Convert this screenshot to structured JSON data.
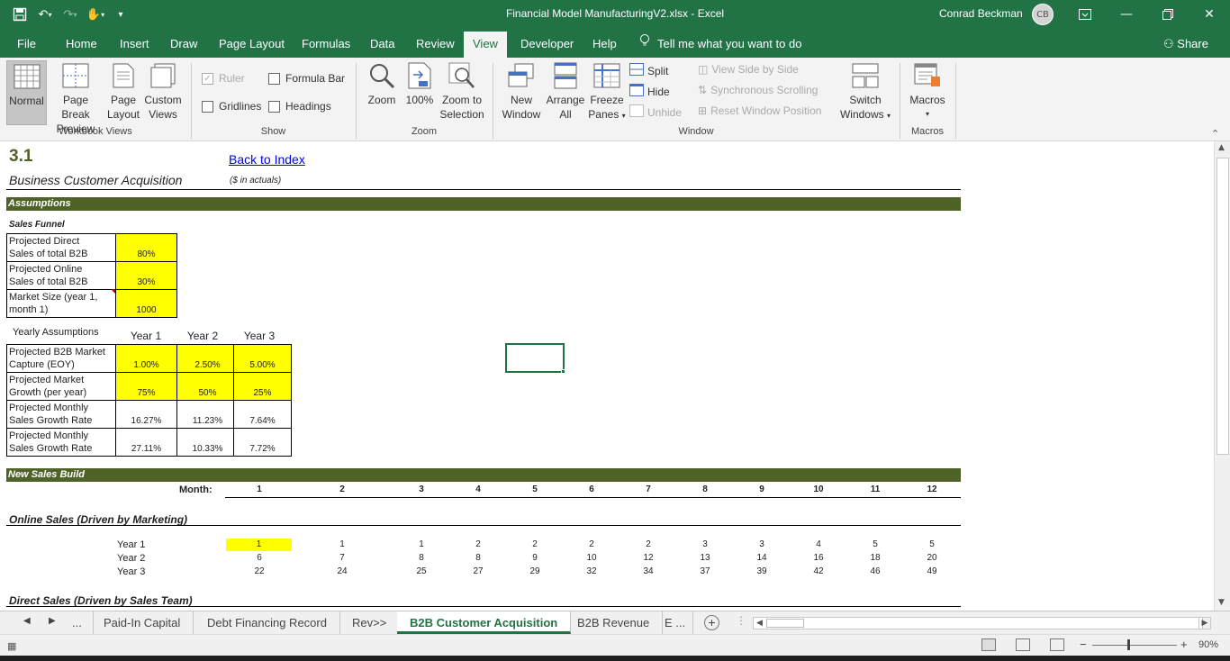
{
  "window": {
    "title": "Financial Model ManufacturingV2.xlsx  -  Excel",
    "user": "Conrad Beckman",
    "initials": "CB"
  },
  "menu": {
    "tabs": [
      "File",
      "Home",
      "Insert",
      "Draw",
      "Page Layout",
      "Formulas",
      "Data",
      "Review",
      "View",
      "Developer",
      "Help"
    ],
    "tell_me": "Tell me what you want to do",
    "share": "Share"
  },
  "ribbon": {
    "workbook_views": {
      "label": "Workbook Views",
      "normal": "Normal",
      "page_break_1": "Page Break",
      "page_break_2": "Preview",
      "page_layout_1": "Page",
      "page_layout_2": "Layout",
      "custom_1": "Custom",
      "custom_2": "Views"
    },
    "show": {
      "label": "Show",
      "ruler": "Ruler",
      "formula_bar": "Formula Bar",
      "gridlines": "Gridlines",
      "headings": "Headings"
    },
    "zoom": {
      "label": "Zoom",
      "zoom": "Zoom",
      "hundred": "100%",
      "zoom_sel_1": "Zoom to",
      "zoom_sel_2": "Selection"
    },
    "window": {
      "label": "Window",
      "new_1": "New",
      "new_2": "Window",
      "arrange_1": "Arrange",
      "arrange_2": "All",
      "freeze_1": "Freeze",
      "freeze_2": "Panes",
      "split": "Split",
      "hide": "Hide",
      "unhide": "Unhide",
      "side_by_side": "View Side by Side",
      "sync_scroll": "Synchronous Scrolling",
      "reset_pos": "Reset Window Position",
      "switch_1": "Switch",
      "switch_2": "Windows"
    },
    "macros": {
      "label": "Macros",
      "macros": "Macros"
    }
  },
  "sheet": {
    "section_num": "3.1",
    "section_title": "Business Customer Acquisition",
    "back_link": "Back to Index",
    "units": "($ in actuals)",
    "assumptions_header": "Assumptions",
    "sales_funnel_label": "Sales Funnel",
    "funnel": [
      {
        "l1": "Projected Direct",
        "l2": "Sales of total B2B",
        "value": "80%"
      },
      {
        "l1": "Projected Online",
        "l2": "Sales of total B2B",
        "value": "30%"
      },
      {
        "l1": "Market Size (year 1,",
        "l2": "month 1)",
        "value": "1000"
      }
    ],
    "yearly_label": "Yearly Assumptions",
    "year_headers": [
      "Year 1",
      "Year 2",
      "Year 3"
    ],
    "yearly": [
      {
        "l1": "Projected B2B Market",
        "l2": "Capture (EOY)",
        "values": [
          "1.00%",
          "2.50%",
          "5.00%"
        ],
        "yellow": true
      },
      {
        "l1": "Projected Market",
        "l2": "Growth (per year)",
        "values": [
          "75%",
          "50%",
          "25%"
        ],
        "yellow": true
      },
      {
        "l1": "Projected Monthly",
        "l2": "Sales Growth Rate",
        "values": [
          "16.27%",
          "11.23%",
          "7.64%"
        ],
        "yellow": false
      },
      {
        "l1": "Projected Monthly",
        "l2": "Sales Growth Rate",
        "values": [
          "27.11%",
          "10.33%",
          "7.72%"
        ],
        "yellow": false
      }
    ],
    "new_sales_header": "New Sales Build",
    "month_label": "Month:",
    "months": [
      "1",
      "2",
      "3",
      "4",
      "5",
      "6",
      "7",
      "8",
      "9",
      "10",
      "11",
      "12"
    ],
    "online_label": "Online Sales (Driven by Marketing)",
    "online_rows": [
      {
        "label": "Year 1",
        "values": [
          "1",
          "1",
          "1",
          "2",
          "2",
          "2",
          "2",
          "3",
          "3",
          "4",
          "5",
          "5"
        ]
      },
      {
        "label": "Year 2",
        "values": [
          "6",
          "7",
          "8",
          "8",
          "9",
          "10",
          "12",
          "13",
          "14",
          "16",
          "18",
          "20"
        ]
      },
      {
        "label": "Year 3",
        "values": [
          "22",
          "24",
          "25",
          "27",
          "29",
          "32",
          "34",
          "37",
          "39",
          "42",
          "46",
          "49"
        ]
      }
    ],
    "direct_label": "Direct Sales (Driven by Sales Team)"
  },
  "tabs": {
    "more": "...",
    "items": [
      "Paid-In Capital",
      "Debt Financing Record",
      "Rev>>",
      "B2B Customer Acquisition",
      "B2B Revenue"
    ],
    "trailing": "E ..."
  },
  "status": {
    "zoom": "90%"
  },
  "colors": {
    "excel_green": "#217346",
    "section_green": "#4f6228",
    "input_yellow": "#ffff00"
  }
}
